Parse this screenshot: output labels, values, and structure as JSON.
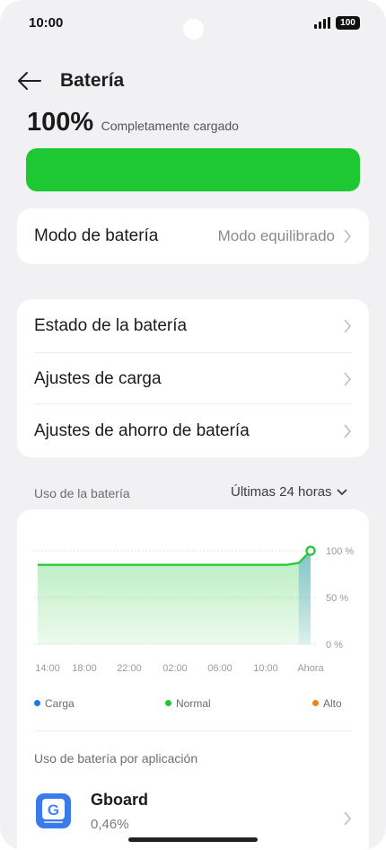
{
  "status_bar": {
    "time": "10:00",
    "battery_level": "100",
    "icons": [
      "signal-icon",
      "battery-icon"
    ]
  },
  "header": {
    "title": "Batería",
    "back_icon": "arrow-left-icon"
  },
  "battery": {
    "percent": "100%",
    "status": "Completamente cargado",
    "level_fraction": 1.0,
    "bar_color": "#1ec832"
  },
  "battery_mode": {
    "label": "Modo de batería",
    "value": "Modo equilibrado"
  },
  "menu": {
    "items": [
      {
        "label": "Estado de la batería"
      },
      {
        "label": "Ajustes de carga"
      },
      {
        "label": "Ajustes de ahorro de batería"
      }
    ]
  },
  "usage": {
    "label": "Uso de la batería",
    "range": "Últimas 24 horas"
  },
  "chart_data": {
    "type": "area",
    "x_ticks": [
      "14:00",
      "18:00",
      "22:00",
      "02:00",
      "06:00",
      "10:00",
      "Ahora"
    ],
    "y_ticks": [
      "100 %",
      "50 %",
      "0 %"
    ],
    "ylim": [
      0,
      100
    ],
    "series": [
      {
        "values": [
          85,
          85,
          85,
          85,
          85,
          85,
          85,
          85,
          85,
          85,
          85,
          85,
          85,
          85,
          85,
          85,
          85,
          85,
          85,
          85,
          85,
          85,
          87,
          100
        ],
        "color": "#1ec832"
      }
    ],
    "charging_since_hour": 22,
    "legend": [
      {
        "label": "Carga",
        "color": "#1f7ae0"
      },
      {
        "label": "Normal",
        "color": "#1ec832"
      },
      {
        "label": "Alto",
        "color": "#f0821e"
      }
    ],
    "grid": true
  },
  "apps": {
    "section_label": "Uso de batería por aplicación",
    "items": [
      {
        "name": "Gboard",
        "usage": "0,46%",
        "icon": "gboard-icon"
      }
    ]
  }
}
